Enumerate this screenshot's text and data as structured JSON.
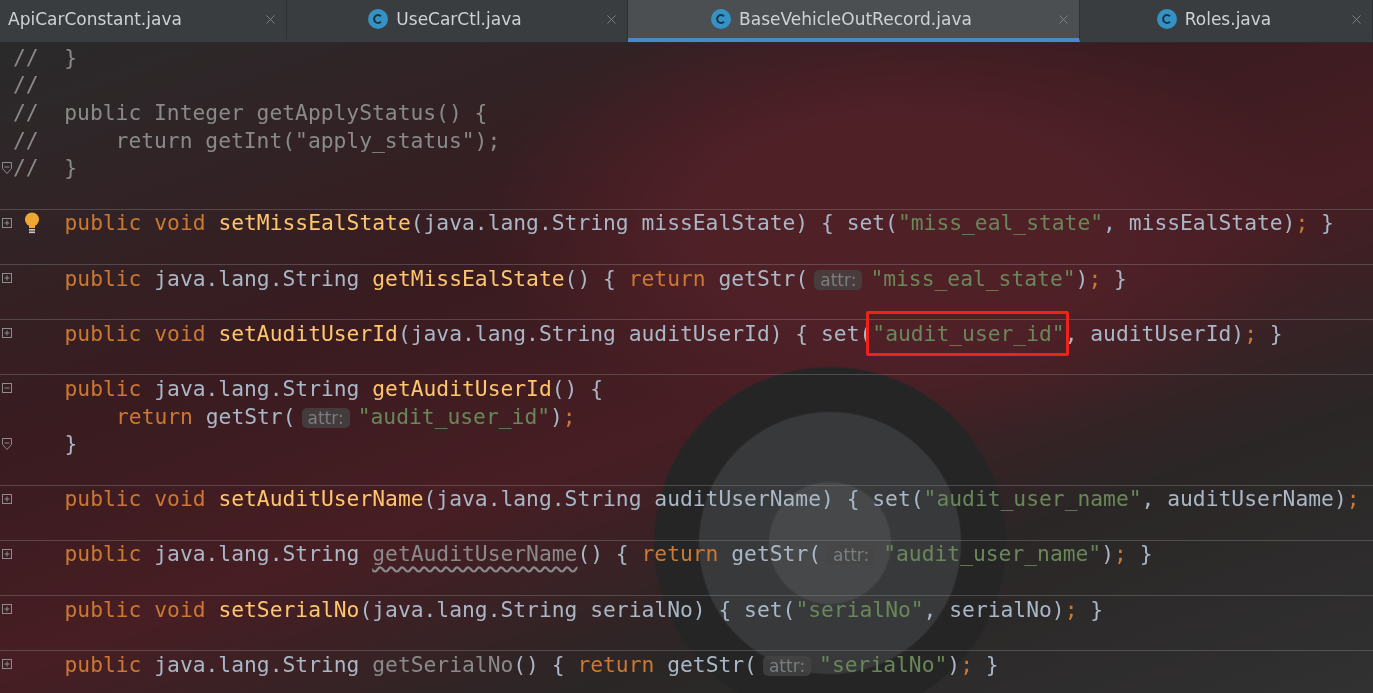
{
  "tabs": [
    {
      "label": "ApiCarConstant.java",
      "selected": false
    },
    {
      "label": "UseCarCtl.java",
      "selected": false
    },
    {
      "label": "BaseVehicleOutRecord.java",
      "selected": true
    },
    {
      "label": "Roles.java",
      "selected": false
    }
  ],
  "editor": {
    "lines": [
      {
        "kind": "plain",
        "separator": false,
        "bulb": false,
        "tokens": [
          {
            "kind": "comment",
            "text": "//  }"
          }
        ]
      },
      {
        "kind": "plain",
        "separator": false,
        "bulb": false,
        "tokens": [
          {
            "kind": "comment",
            "text": "//"
          }
        ]
      },
      {
        "kind": "plain",
        "separator": false,
        "bulb": false,
        "tokens": [
          {
            "kind": "comment",
            "text": "//  public Integer getApplyStatus() {"
          }
        ]
      },
      {
        "kind": "plain",
        "separator": false,
        "bulb": false,
        "tokens": [
          {
            "kind": "comment",
            "text": "//      return getInt(\"apply_status\");"
          }
        ]
      },
      {
        "kind": "close",
        "separator": false,
        "bulb": false,
        "tokens": [
          {
            "kind": "comment",
            "text": "//  }"
          }
        ]
      },
      {
        "kind": "blank",
        "separator": false,
        "bulb": false
      },
      {
        "kind": "folded",
        "separator": true,
        "bulb": true,
        "tokens": [
          {
            "kind": "keyword",
            "text": "public void "
          },
          {
            "kind": "method",
            "text": "setMissEalState"
          },
          {
            "kind": "plain",
            "text": "(java.lang.String missEalState) { set("
          },
          {
            "kind": "string",
            "text": "\"miss_eal_state\""
          },
          {
            "kind": "plain",
            "text": ", missEalState)"
          },
          {
            "kind": "keyword",
            "text": ";"
          },
          {
            "kind": "plain",
            "text": " }"
          }
        ]
      },
      {
        "kind": "blank",
        "separator": false,
        "bulb": false
      },
      {
        "kind": "folded",
        "separator": true,
        "bulb": false,
        "tokens": [
          {
            "kind": "keyword",
            "text": "public "
          },
          {
            "kind": "plain",
            "text": "java.lang.String "
          },
          {
            "kind": "method",
            "text": "getMissEalState"
          },
          {
            "kind": "plain",
            "text": "() { "
          },
          {
            "kind": "keyword",
            "text": "return "
          },
          {
            "kind": "plain",
            "text": "getStr("
          },
          {
            "kind": "hint",
            "text": "attr:"
          },
          {
            "kind": "string",
            "text": "\"miss_eal_state\""
          },
          {
            "kind": "plain",
            "text": ")"
          },
          {
            "kind": "keyword",
            "text": ";"
          },
          {
            "kind": "plain",
            "text": " }"
          }
        ]
      },
      {
        "kind": "blank",
        "separator": false,
        "bulb": false
      },
      {
        "kind": "folded",
        "separator": true,
        "bulb": false,
        "tokens": [
          {
            "kind": "keyword",
            "text": "public void "
          },
          {
            "kind": "method",
            "text": "setAuditUserId"
          },
          {
            "kind": "plain",
            "text": "(java.lang.String auditUserId) { set("
          },
          {
            "kind": "string",
            "text": "\"audit_user_id\"",
            "framed": true
          },
          {
            "kind": "plain",
            "text": ", auditUserId)"
          },
          {
            "kind": "keyword",
            "text": ";"
          },
          {
            "kind": "plain",
            "text": " }"
          }
        ]
      },
      {
        "kind": "blank",
        "separator": false,
        "bulb": false
      },
      {
        "kind": "open",
        "separator": true,
        "bulb": false,
        "tokens": [
          {
            "kind": "keyword",
            "text": "public "
          },
          {
            "kind": "plain",
            "text": "java.lang.String "
          },
          {
            "kind": "method",
            "text": "getAuditUserId"
          },
          {
            "kind": "plain",
            "text": "() {"
          }
        ]
      },
      {
        "kind": "plain",
        "separator": false,
        "bulb": false,
        "tokens": [
          {
            "kind": "keyword",
            "text": "return "
          },
          {
            "kind": "plain",
            "text": "getStr("
          },
          {
            "kind": "hint",
            "text": "attr:"
          },
          {
            "kind": "string",
            "text": "\"audit_user_id\""
          },
          {
            "kind": "plain",
            "text": ")"
          },
          {
            "kind": "keyword",
            "text": ";"
          }
        ]
      },
      {
        "kind": "close",
        "separator": false,
        "bulb": false,
        "tokens": [
          {
            "kind": "plain",
            "text": "}"
          }
        ]
      },
      {
        "kind": "blank",
        "separator": false,
        "bulb": false
      },
      {
        "kind": "folded",
        "separator": true,
        "bulb": false,
        "tokens": [
          {
            "kind": "keyword",
            "text": "public void "
          },
          {
            "kind": "method",
            "text": "setAuditUserName"
          },
          {
            "kind": "plain",
            "text": "(java.lang.String auditUserName) { set("
          },
          {
            "kind": "string",
            "text": "\"audit_user_name\""
          },
          {
            "kind": "plain",
            "text": ", auditUserName)"
          },
          {
            "kind": "keyword",
            "text": ";"
          }
        ]
      },
      {
        "kind": "blank",
        "separator": false,
        "bulb": false
      },
      {
        "kind": "folded",
        "separator": true,
        "bulb": false,
        "tokens": [
          {
            "kind": "keyword",
            "text": "public "
          },
          {
            "kind": "plain",
            "text": "java.lang.String "
          },
          {
            "kind": "unused",
            "text": "getAuditUserName"
          },
          {
            "kind": "plain",
            "text": "() { "
          },
          {
            "kind": "keyword",
            "text": "return "
          },
          {
            "kind": "plain",
            "text": "getStr("
          },
          {
            "kind": "hint",
            "text": "attr:"
          },
          {
            "kind": "string",
            "text": "\"audit_user_name\""
          },
          {
            "kind": "plain",
            "text": ")"
          },
          {
            "kind": "keyword",
            "text": ";"
          },
          {
            "kind": "plain",
            "text": " }"
          }
        ]
      },
      {
        "kind": "blank",
        "separator": false,
        "bulb": false
      },
      {
        "kind": "folded",
        "separator": true,
        "bulb": false,
        "tokens": [
          {
            "kind": "keyword",
            "text": "public void "
          },
          {
            "kind": "method",
            "text": "setSerialNo"
          },
          {
            "kind": "plain",
            "text": "(java.lang.String serialNo) { set("
          },
          {
            "kind": "string",
            "text": "\"serialNo\""
          },
          {
            "kind": "plain",
            "text": ", serialNo)"
          },
          {
            "kind": "keyword",
            "text": ";"
          },
          {
            "kind": "plain",
            "text": " }"
          }
        ]
      },
      {
        "kind": "blank",
        "separator": false,
        "bulb": false
      },
      {
        "kind": "folded",
        "separator": true,
        "bulb": false,
        "tokens": [
          {
            "kind": "keyword",
            "text": "public "
          },
          {
            "kind": "plain",
            "text": "java.lang.String "
          },
          {
            "kind": "faded",
            "text": "getSerialNo"
          },
          {
            "kind": "plain",
            "text": "() { "
          },
          {
            "kind": "keyword",
            "text": "return "
          },
          {
            "kind": "plain",
            "text": "getStr("
          },
          {
            "kind": "hint",
            "text": "attr:"
          },
          {
            "kind": "string",
            "text": "\"serialNo\""
          },
          {
            "kind": "plain",
            "text": ")"
          },
          {
            "kind": "keyword",
            "text": ";"
          },
          {
            "kind": "plain",
            "text": " }"
          }
        ]
      }
    ]
  }
}
